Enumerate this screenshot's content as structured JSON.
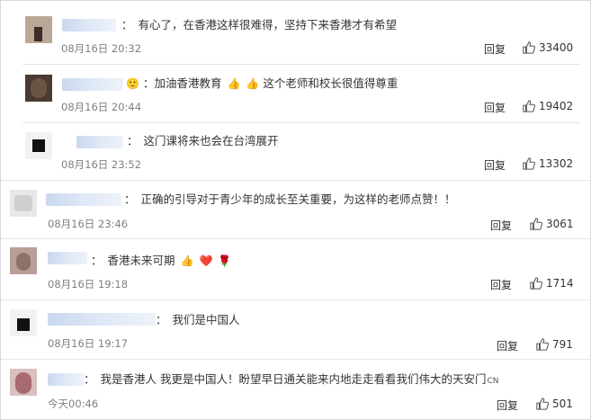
{
  "comments": [
    {
      "text": "有心了，在香港这样很难得，坚持下来香港才有希望",
      "time": "08月16日 20:32",
      "reply": "回复",
      "likes": "33400",
      "emoji": []
    },
    {
      "text": "加油香港教育",
      "emoji": [
        "👍",
        "👍"
      ],
      "text2": "这个老师和校长很值得尊重",
      "time": "08月16日 20:44",
      "reply": "回复",
      "likes": "19402"
    },
    {
      "text": "这门课将来也会在台湾展开",
      "time": "08月16日 23:52",
      "reply": "回复",
      "likes": "13302",
      "emoji": []
    },
    {
      "text": "正确的引导对于青少年的成长至关重要，为这样的老师点赞！！",
      "time": "08月16日 23:46",
      "reply": "回复",
      "likes": "3061",
      "emoji": []
    },
    {
      "text": "香港未来可期",
      "emoji": [
        "👍",
        "❤️",
        "🌹"
      ],
      "time": "08月16日 19:18",
      "reply": "回复",
      "likes": "1714"
    },
    {
      "text": "我们是中国人",
      "time": "08月16日 19:17",
      "reply": "回复",
      "likes": "791",
      "emoji": []
    },
    {
      "text": "我是香港人 我更是中国人！盼望早日通关能来内地走走看看我们伟大的天安门",
      "suffix": "CN",
      "time": "今天00:46",
      "reply": "回复",
      "likes": "501",
      "emoji": []
    }
  ],
  "colon": "：",
  "icons": {
    "like": "thumbs-up-icon"
  }
}
